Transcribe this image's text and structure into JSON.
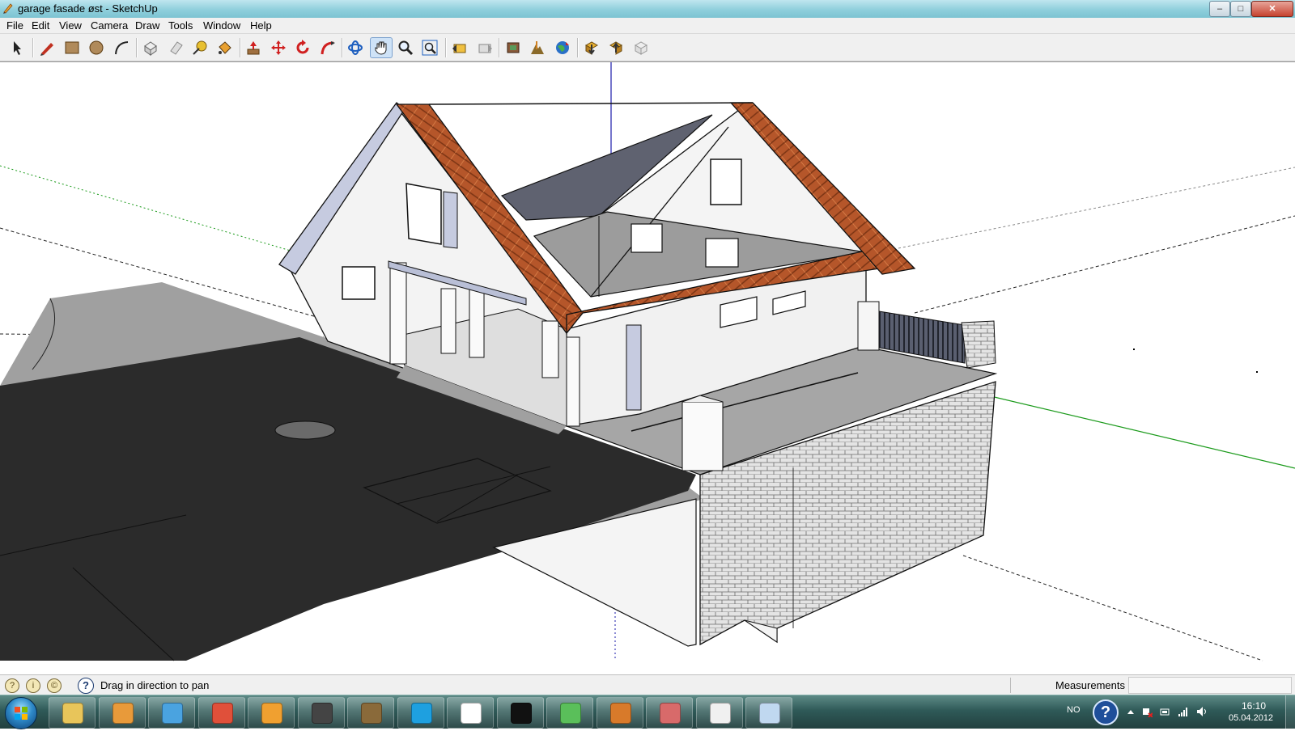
{
  "window": {
    "title": "garage fasade øst - SketchUp",
    "controls": {
      "minimize": "–",
      "maximize": "□",
      "close": "✕"
    }
  },
  "menu": [
    "File",
    "Edit",
    "View",
    "Camera",
    "Draw",
    "Tools",
    "Window",
    "Help"
  ],
  "toolbar": {
    "tools": [
      {
        "name": "select-tool",
        "icon": "arrow-pointer-icon"
      },
      {
        "name": "pencil-tool",
        "icon": "pencil-icon"
      },
      {
        "name": "rectangle-tool",
        "icon": "rectangle-icon"
      },
      {
        "name": "circle-tool",
        "icon": "circle-icon"
      },
      {
        "name": "arc-tool",
        "icon": "arc-icon"
      },
      {
        "name": "make-component-tool",
        "icon": "component-icon"
      },
      {
        "name": "eraser-tool",
        "icon": "eraser-icon"
      },
      {
        "name": "tape-measure-tool",
        "icon": "tape-measure-icon"
      },
      {
        "name": "paint-bucket-tool",
        "icon": "paint-bucket-icon"
      },
      {
        "name": "push-pull-tool",
        "icon": "push-pull-icon"
      },
      {
        "name": "move-tool",
        "icon": "move-icon"
      },
      {
        "name": "rotate-tool",
        "icon": "rotate-icon"
      },
      {
        "name": "follow-me-tool",
        "icon": "follow-me-icon"
      },
      {
        "name": "orbit-tool",
        "icon": "orbit-icon"
      },
      {
        "name": "pan-tool",
        "icon": "hand-icon",
        "active": true
      },
      {
        "name": "zoom-tool",
        "icon": "magnifier-icon"
      },
      {
        "name": "zoom-extents-tool",
        "icon": "zoom-extents-icon"
      },
      {
        "name": "previous-view-tool",
        "icon": "previous-view-icon"
      },
      {
        "name": "next-view-tool",
        "icon": "next-view-icon"
      },
      {
        "name": "add-location-tool",
        "icon": "add-location-icon"
      },
      {
        "name": "toggle-terrain-tool",
        "icon": "terrain-icon"
      },
      {
        "name": "google-earth-tool",
        "icon": "globe-icon"
      },
      {
        "name": "get-models-tool",
        "icon": "get-models-icon"
      },
      {
        "name": "share-model-tool",
        "icon": "share-model-icon"
      },
      {
        "name": "share-component-tool",
        "icon": "share-component-icon"
      }
    ]
  },
  "status": {
    "message": "Drag in direction to pan",
    "measurements_label": "Measurements",
    "measurements_value": ""
  },
  "taskbar": {
    "apps": [
      {
        "name": "explorer",
        "icon": "folder-icon",
        "color": "#e8c55a"
      },
      {
        "name": "media-player",
        "icon": "media-player-icon",
        "color": "#e89a3a"
      },
      {
        "name": "network",
        "icon": "wifi-icon",
        "color": "#4aa3e0"
      },
      {
        "name": "chrome",
        "icon": "chrome-icon",
        "color": "#e0503a"
      },
      {
        "name": "outlook",
        "icon": "outlook-icon",
        "color": "#f0a030"
      },
      {
        "name": "inkscape",
        "icon": "inkscape-icon",
        "color": "#444444"
      },
      {
        "name": "gimp",
        "icon": "gimp-icon",
        "color": "#8a6a3a"
      },
      {
        "name": "skype",
        "icon": "skype-icon",
        "color": "#1ea0e0"
      },
      {
        "name": "wunderlist",
        "icon": "w-icon",
        "color": "#ffffff"
      },
      {
        "name": "app-circle",
        "icon": "ring-icon",
        "color": "#111111"
      },
      {
        "name": "messenger",
        "icon": "messenger-icon",
        "color": "#5abf5a"
      },
      {
        "name": "photo-viewer",
        "icon": "photo-icon",
        "color": "#d87a2a"
      },
      {
        "name": "sketchup-layout",
        "icon": "layout-icon",
        "color": "#d86a6a"
      },
      {
        "name": "sketchup",
        "icon": "sketchup-icon",
        "color": "#f0f0f0"
      },
      {
        "name": "paint",
        "icon": "palette-icon",
        "color": "#c0d8f0"
      }
    ],
    "language": "NO",
    "time": "16:10",
    "date": "05.04.2012"
  },
  "colors": {
    "roof_tile": "#b5562a",
    "wall": "#f3f3f3",
    "terrace": "#9a9a9a",
    "asphalt": "#2a2a2a",
    "stone": "#d9d9d9",
    "axis_red": "#cc0000",
    "axis_green": "#00a000",
    "axis_blue": "#0000cc"
  }
}
